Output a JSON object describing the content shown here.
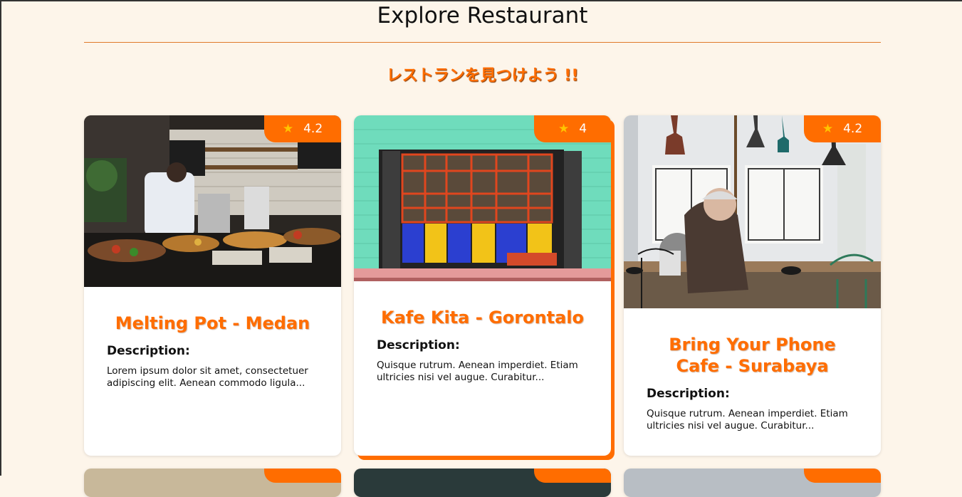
{
  "header": {
    "title": "Explore Restaurant",
    "subtitle": "レストランを見つけよう !!"
  },
  "restaurants": [
    {
      "name": "Melting Pot - Medan",
      "rating": "4.2",
      "description_label": "Description:",
      "description": "Lorem ipsum dolor sit amet, consectetuer adipiscing elit. Aenean commodo ligula..."
    },
    {
      "name": "Kafe Kita - Gorontalo",
      "rating": "4",
      "description_label": "Description:",
      "description": "Quisque rutrum. Aenean imperdiet. Etiam ultricies nisi vel augue. Curabitur..."
    },
    {
      "name": "Bring Your Phone Cafe - Surabaya",
      "rating": "4.2",
      "description_label": "Description:",
      "description": "Quisque rutrum. Aenean imperdiet. Etiam ultricies nisi vel augue. Curabitur..."
    }
  ],
  "icons": {
    "rating": "star-icon"
  },
  "colors": {
    "accent": "#ff6d00",
    "background": "#fdf5ea",
    "star": "#ffc400"
  }
}
